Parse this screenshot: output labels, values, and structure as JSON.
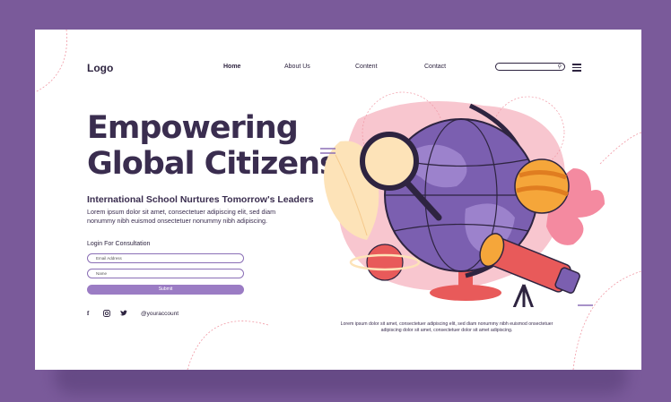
{
  "logo": "Logo",
  "nav": {
    "items": [
      "Home",
      "About Us",
      "Content",
      "Contact"
    ]
  },
  "search": {
    "icon": "search-icon"
  },
  "hero": {
    "title_line1": "Empowering",
    "title_line2": "Global Citizens",
    "subtitle": "International School Nurtures Tomorrow's Leaders",
    "description": "Lorem ipsum dolor sit amet, consectetuer adipiscing elit, sed diam nonummy nibh euismod onsectetuer nonummy nibh adipiscing."
  },
  "form": {
    "label": "Login For Consultation",
    "email_placeholder": "Email Address",
    "name_placeholder": "Name",
    "submit_label": "Submit"
  },
  "social": {
    "icons": [
      "facebook-icon",
      "instagram-icon",
      "twitter-icon"
    ],
    "facebook_glyph": "f",
    "twitter_glyph": "🐦",
    "account": "@youraccount"
  },
  "caption": "Lorem ipsum dolor sit amet, consectetuer adipiscing elit, sed diam nonummy nibh euismod onsectetuer adipiscing dolor sit amet, consectetuer dolor sit amet adipiscing.",
  "colors": {
    "background": "#7a5a9a",
    "accent": "#9b7cc4",
    "text": "#3a2d4f",
    "globe": "#7b5fb0",
    "pink": "#f8c6cf",
    "orange": "#f5a63a"
  }
}
